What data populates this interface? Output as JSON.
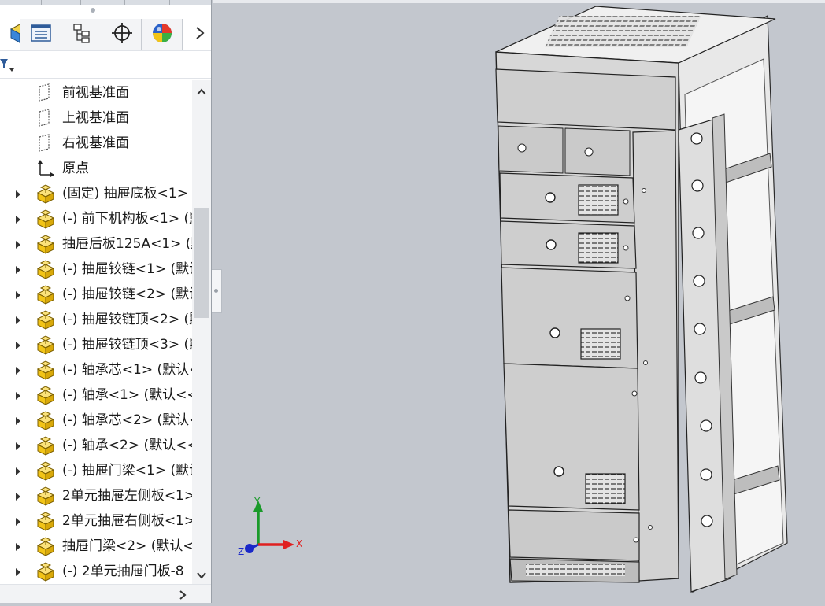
{
  "panel": {
    "tabs": [
      {
        "icon": "cube-icon"
      },
      {
        "icon": "property-manager-icon"
      },
      {
        "icon": "configuration-manager-icon"
      },
      {
        "icon": "crosshair-icon"
      },
      {
        "icon": "appearance-sphere-icon"
      }
    ],
    "more_icon": "chevron-right-icon",
    "filter_icon": "filter-icon"
  },
  "tree": {
    "items": [
      {
        "label": "前视基准面",
        "icon": "plane-icon",
        "expandable": false
      },
      {
        "label": "上视基准面",
        "icon": "plane-icon",
        "expandable": false
      },
      {
        "label": "右视基准面",
        "icon": "plane-icon",
        "expandable": false
      },
      {
        "label": "原点",
        "icon": "origin-icon",
        "expandable": false
      },
      {
        "label": "(固定) 抽屉底板<1> (",
        "icon": "part-icon",
        "expandable": true
      },
      {
        "label": "(-) 前下机构板<1> (默",
        "icon": "part-icon",
        "expandable": true
      },
      {
        "label": "抽屉后板125A<1> (默",
        "icon": "part-icon",
        "expandable": true
      },
      {
        "label": "(-) 抽屉铰链<1> (默认",
        "icon": "part-icon",
        "expandable": true
      },
      {
        "label": "(-) 抽屉铰链<2> (默认",
        "icon": "part-icon",
        "expandable": true
      },
      {
        "label": "(-) 抽屉铰链顶<2> (默",
        "icon": "part-icon",
        "expandable": true
      },
      {
        "label": "(-) 抽屉铰链顶<3> (默",
        "icon": "part-icon",
        "expandable": true
      },
      {
        "label": "(-) 轴承芯<1> (默认<",
        "icon": "part-icon",
        "expandable": true
      },
      {
        "label": "(-) 轴承<1> (默认<<",
        "icon": "part-icon",
        "expandable": true
      },
      {
        "label": "(-) 轴承芯<2> (默认<",
        "icon": "part-icon",
        "expandable": true
      },
      {
        "label": "(-) 轴承<2> (默认<<",
        "icon": "part-icon",
        "expandable": true
      },
      {
        "label": "(-) 抽屉门梁<1> (默认",
        "icon": "part-icon",
        "expandable": true
      },
      {
        "label": "2单元抽屉左侧板<1>",
        "icon": "part-icon",
        "expandable": true
      },
      {
        "label": "2单元抽屉右侧板<1>",
        "icon": "part-icon",
        "expandable": true
      },
      {
        "label": "抽屉门梁<2> (默认<",
        "icon": "part-icon",
        "expandable": true
      },
      {
        "label": "(-) 2单元抽屉门板-8",
        "icon": "part-icon",
        "expandable": true
      }
    ]
  },
  "triad": {
    "x": "X",
    "y": "Y",
    "z": "Z"
  },
  "colors": {
    "viewport_bg": "#c3c7ce",
    "part_yellow": "#f2c417",
    "axis_x": "#e02020",
    "axis_y": "#1a9a2a",
    "axis_z": "#1a28c8"
  }
}
